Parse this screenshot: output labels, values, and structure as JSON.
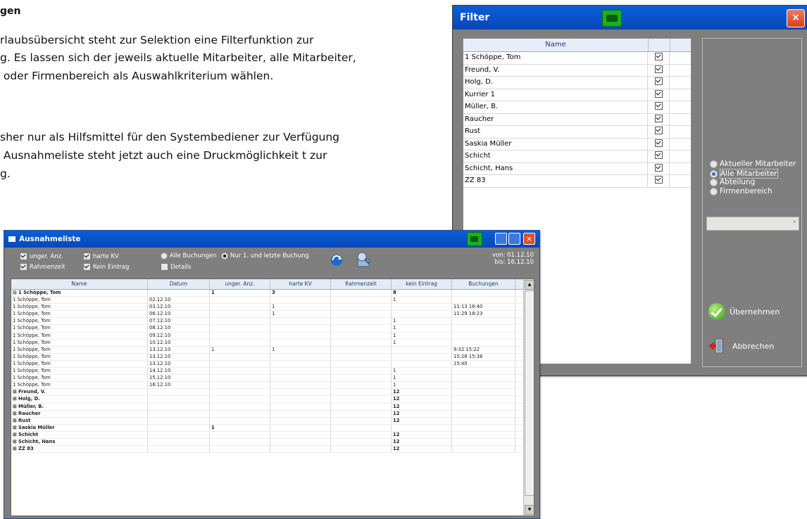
{
  "document": {
    "heading": "gen",
    "paragraph1": [
      "rlaubsübersicht steht zur Selektion eine Filterfunktion zur",
      "g. Es lassen sich der jeweils aktuelle Mitarbeiter, alle Mitarbeiter,",
      " oder Firmenbereich als Auswahlkriterium wählen."
    ],
    "paragraph2": [
      "sher nur als Hilfsmittel für den Systembediener zur Verfügung",
      " Ausnahmeliste steht jetzt auch eine Druckmöglichkeit t zur",
      "g."
    ]
  },
  "filter_window": {
    "title": "Filter",
    "close_label": "×",
    "column_name": "Name",
    "names": [
      "1 Schöppe, Tom",
      "Freund, V.",
      "Holg, D.",
      "Kurrier 1",
      "Müller, B.",
      "Raucher",
      "Rust",
      "Saskia Müller",
      "Schicht",
      "Schicht, Hans",
      "ZZ 83"
    ],
    "radio_options": [
      "Aktueller Mitarbeiter",
      "Alle Mitarbeiter",
      "Abteilung",
      "Firmenbereich"
    ],
    "selected_option": "Alle Mitarbeiter",
    "combo_value": "",
    "apply_label": "Übernehmen",
    "cancel_label": "Abbrechen"
  },
  "ausnahme_window": {
    "title": "Ausnahmeliste",
    "options": {
      "unger_anz": "unger. Anz.",
      "harte_kv": "harte KV",
      "rahmenzeit": "Rahmenzeit",
      "kein_eintrag": "Kein Eintrag",
      "alle_buchungen": "Alle Buchungen",
      "nur_erste_letzte": "Nur 1. und letzte Buchung",
      "details": "Details"
    },
    "von_label": "von: 01.12.10",
    "bis_label": "bis: 16.12.10",
    "columns": [
      "Name",
      "Datum",
      "unger. Anz.",
      "harte KV",
      "Rahmenzeit",
      "kein Eintrag",
      "Buchungen"
    ],
    "rows": [
      [
        "⊟ 1 Schöppe, Tom",
        "",
        "1",
        "3",
        "",
        "8",
        ""
      ],
      [
        "1 Schöppe, Tom",
        "02.12.10",
        "",
        "",
        "",
        "1",
        ""
      ],
      [
        "1 Schöppe, Tom",
        "03.12.10",
        "",
        "1",
        "",
        "",
        "11:13   16:40"
      ],
      [
        "1 Schöppe, Tom",
        "06.12.10",
        "",
        "1",
        "",
        "",
        "11:29   18:23"
      ],
      [
        "1 Schöppe, Tom",
        "07.12.10",
        "",
        "",
        "",
        "1",
        ""
      ],
      [
        "1 Schöppe, Tom",
        "08.12.10",
        "",
        "",
        "",
        "1",
        ""
      ],
      [
        "1 Schöppe, Tom",
        "09.12.10",
        "",
        "",
        "",
        "1",
        ""
      ],
      [
        "1 Schöppe, Tom",
        "10.12.10",
        "",
        "",
        "",
        "1",
        ""
      ],
      [
        "1 Schöppe, Tom",
        "13.12.10",
        "1",
        "1",
        "",
        "",
        "9:32   15:22"
      ],
      [
        "1 Schöppe, Tom",
        "13.12.10",
        "",
        "",
        "",
        "",
        "15:28   15:38"
      ],
      [
        "1 Schöppe, Tom",
        "13.12.10",
        "",
        "",
        "",
        "",
        "15:40"
      ],
      [
        "1 Schöppe, Tom",
        "14.12.10",
        "",
        "",
        "",
        "1",
        ""
      ],
      [
        "1 Schöppe, Tom",
        "15.12.10",
        "",
        "",
        "",
        "1",
        ""
      ],
      [
        "1 Schöppe, Tom",
        "16.12.10",
        "",
        "",
        "",
        "1",
        ""
      ],
      [
        "⊞ Freund, V.",
        "",
        "",
        "",
        "",
        "12",
        ""
      ],
      [
        "⊞ Holg, D.",
        "",
        "",
        "",
        "",
        "12",
        ""
      ],
      [
        "⊞ Müller, B.",
        "",
        "",
        "",
        "",
        "12",
        ""
      ],
      [
        "⊞ Raucher",
        "",
        "",
        "",
        "",
        "12",
        ""
      ],
      [
        "⊞ Rust",
        "",
        "",
        "",
        "",
        "12",
        ""
      ],
      [
        "⊞ Saskia Müller",
        "",
        "1",
        "",
        "",
        "",
        ""
      ],
      [
        "⊞ Schicht",
        "",
        "",
        "",
        "",
        "12",
        ""
      ],
      [
        "⊞ Schicht, Hans",
        "",
        "",
        "",
        "",
        "12",
        ""
      ],
      [
        "⊞ ZZ 83",
        "",
        "",
        "",
        "",
        "12",
        ""
      ]
    ]
  }
}
